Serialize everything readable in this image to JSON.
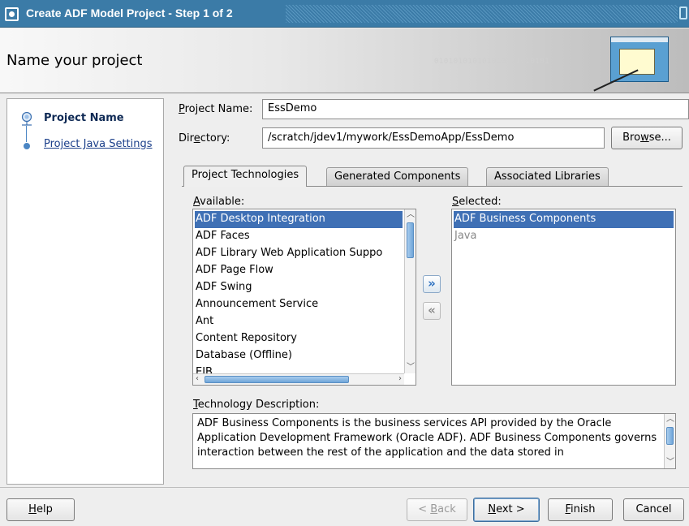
{
  "window": {
    "title": "Create ADF Model Project - Step 1 of 2"
  },
  "header": {
    "title": "Name your project",
    "binary_text": "010101010101010101010101"
  },
  "steps": [
    {
      "label": "Project Name",
      "state": "current"
    },
    {
      "label": "Project Java Settings",
      "state": "link"
    }
  ],
  "form": {
    "project_name_label_pre": "",
    "project_name_label_mn": "P",
    "project_name_label_post": "roject Name:",
    "project_name_value": "EssDemo",
    "directory_label_pre": "Dir",
    "directory_label_mn": "e",
    "directory_label_post": "ctory:",
    "directory_value": "/scratch/jdev1/mywork/EssDemoApp/EssDemo",
    "browse_pre": "Bro",
    "browse_mn": "w",
    "browse_post": "se..."
  },
  "tabs": [
    {
      "label": "Project Technologies",
      "active": true
    },
    {
      "label": "Generated Components",
      "active": false
    },
    {
      "label": "Associated Libraries",
      "active": false
    }
  ],
  "available": {
    "label_mn": "A",
    "label_post": "vailable:",
    "items": [
      "ADF Desktop Integration",
      "ADF Faces",
      "ADF Library Web Application Suppo",
      "ADF Page Flow",
      "ADF Swing",
      "Announcement Service",
      "Ant",
      "Content Repository",
      "Database (Offline)",
      "EJB"
    ],
    "selected_index": 0
  },
  "selected": {
    "label_mn": "S",
    "label_post": "elected:",
    "items": [
      {
        "label": "ADF Business Components",
        "selected": true,
        "disabled": false
      },
      {
        "label": "Java",
        "selected": false,
        "disabled": true
      }
    ]
  },
  "move_buttons": {
    "add_glyph": "»",
    "remove_glyph": "«"
  },
  "description": {
    "label_mn": "T",
    "label_post": "echnology Description:",
    "text": "ADF Business Components is the business services API provided by the Oracle Application Development Framework (Oracle ADF).  ADF Business Components governs interaction between the rest of the application and the data stored in"
  },
  "footer": {
    "help_mn": "H",
    "help_post": "elp",
    "back_pre": "< ",
    "back_mn": "B",
    "back_post": "ack",
    "next_mn": "N",
    "next_post": "ext >",
    "finish_mn": "F",
    "finish_post": "inish",
    "cancel": "Cancel"
  },
  "colors": {
    "titlebar": "#3b7ba7",
    "selection": "#3f70b5",
    "link": "#1b3f8a"
  }
}
